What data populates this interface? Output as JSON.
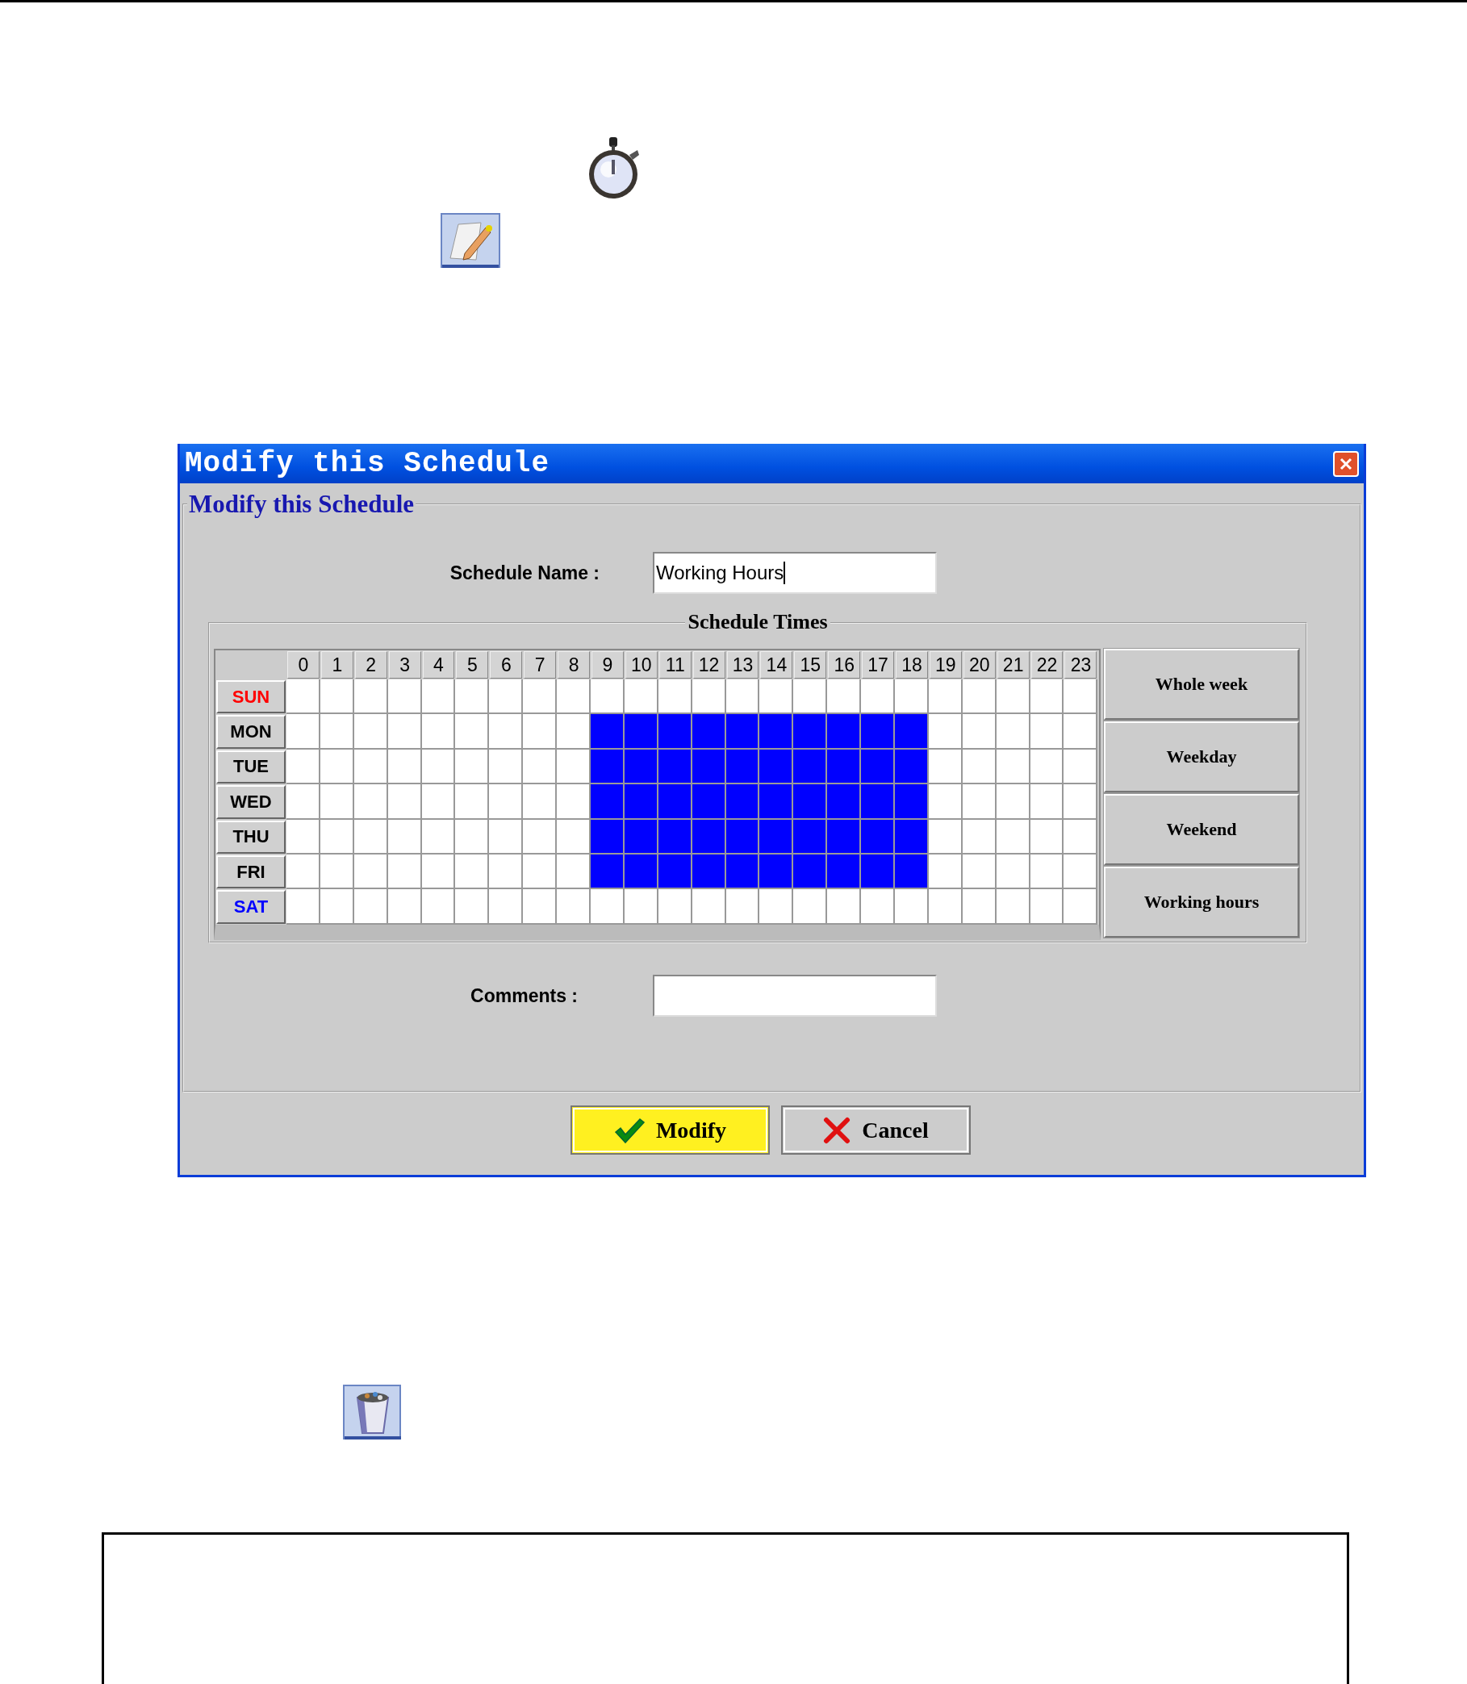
{
  "window": {
    "title": "Modify this Schedule"
  },
  "form": {
    "legend": "Modify this Schedule",
    "fields": [
      {
        "label": "Schedule Name :",
        "value": "Working Hours",
        "focused": true
      },
      {
        "label": "Comments :",
        "focused": false
      }
    ]
  },
  "schedule": {
    "title": "Schedule Times",
    "hours": [
      "0",
      "1",
      "2",
      "3",
      "4",
      "5",
      "6",
      "7",
      "8",
      "9",
      "10",
      "11",
      "12",
      "13",
      "14",
      "15",
      "16",
      "17",
      "18",
      "19",
      "20",
      "21",
      "22",
      "23"
    ],
    "days": [
      {
        "label": "SUN",
        "color": "#ff0000",
        "slots": [
          false,
          false,
          false,
          false,
          false,
          false,
          false,
          false,
          false,
          false,
          false,
          false,
          false,
          false,
          false,
          false,
          false,
          false,
          false,
          false,
          false,
          false,
          false,
          false
        ]
      },
      {
        "label": "MON",
        "color": "#000000",
        "slots": [
          false,
          false,
          false,
          false,
          false,
          false,
          false,
          false,
          false,
          true,
          true,
          true,
          true,
          true,
          true,
          true,
          true,
          true,
          true,
          false,
          false,
          false,
          false,
          false
        ]
      },
      {
        "label": "TUE",
        "color": "#000000",
        "slots": [
          false,
          false,
          false,
          false,
          false,
          false,
          false,
          false,
          false,
          true,
          true,
          true,
          true,
          true,
          true,
          true,
          true,
          true,
          true,
          false,
          false,
          false,
          false,
          false
        ]
      },
      {
        "label": "WED",
        "color": "#000000",
        "slots": [
          false,
          false,
          false,
          false,
          false,
          false,
          false,
          false,
          false,
          true,
          true,
          true,
          true,
          true,
          true,
          true,
          true,
          true,
          true,
          false,
          false,
          false,
          false,
          false
        ]
      },
      {
        "label": "THU",
        "color": "#000000",
        "slots": [
          false,
          false,
          false,
          false,
          false,
          false,
          false,
          false,
          false,
          true,
          true,
          true,
          true,
          true,
          true,
          true,
          true,
          true,
          true,
          false,
          false,
          false,
          false,
          false
        ]
      },
      {
        "label": "FRI",
        "color": "#000000",
        "slots": [
          false,
          false,
          false,
          false,
          false,
          false,
          false,
          false,
          false,
          true,
          true,
          true,
          true,
          true,
          true,
          true,
          true,
          true,
          true,
          false,
          false,
          false,
          false,
          false
        ]
      },
      {
        "label": "SAT",
        "color": "#0000ff",
        "slots": [
          false,
          false,
          false,
          false,
          false,
          false,
          false,
          false,
          false,
          false,
          false,
          false,
          false,
          false,
          false,
          false,
          false,
          false,
          false,
          false,
          false,
          false,
          false,
          false
        ]
      }
    ],
    "presets": [
      "Whole week",
      "Weekday",
      "Weekend",
      "Working hours"
    ]
  },
  "buttons": [
    {
      "label": "Modify",
      "kind": "confirm",
      "highlighted": true
    },
    {
      "label": "Cancel",
      "kind": "cancel",
      "highlighted": false
    }
  ]
}
